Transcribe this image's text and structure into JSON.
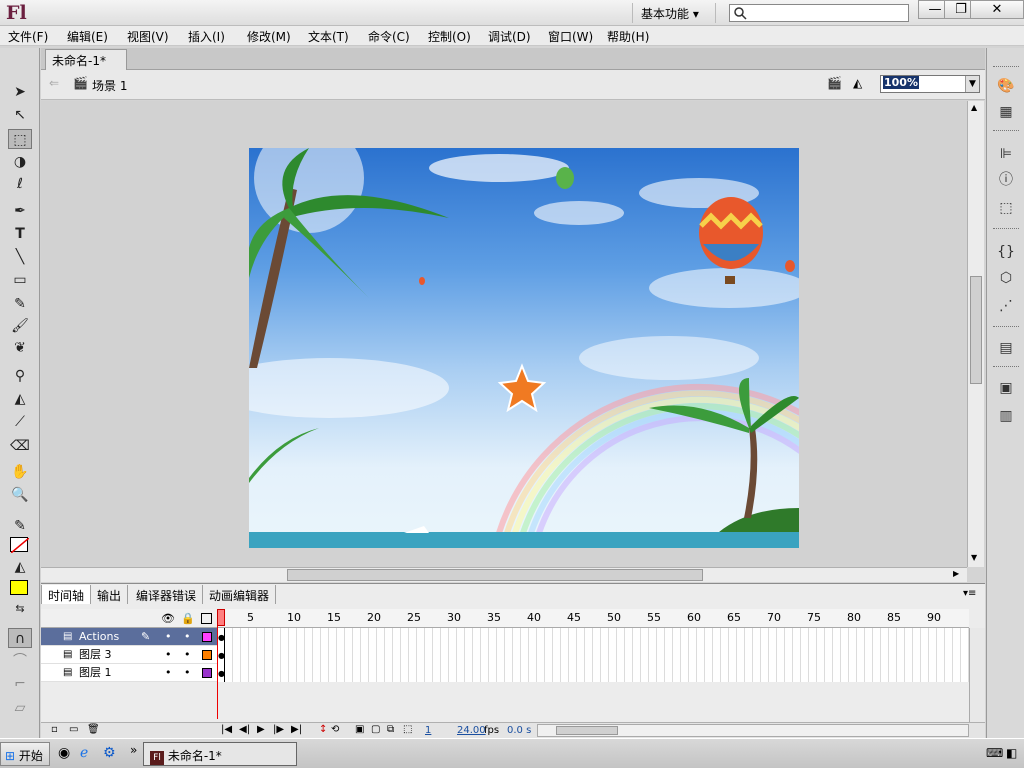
{
  "app": {
    "logo": "Fl",
    "workspace": "基本功能 ▾"
  },
  "window_buttons": {
    "minimize": "—",
    "restore": "❐",
    "close": "✕"
  },
  "menu": [
    "文件(F)",
    "编辑(E)",
    "视图(V)",
    "插入(I)",
    "修改(M)",
    "文本(T)",
    "命令(C)",
    "控制(O)",
    "调试(D)",
    "窗口(W)",
    "帮助(H)"
  ],
  "document": {
    "tab_title": "未命名-1*",
    "tab_close": "×",
    "scene": "场景 1",
    "zoom": "100%"
  },
  "tools": [
    "arrow-icon",
    "subselect-icon",
    "free-transform-icon",
    "3d-rotation-icon",
    "lasso-icon",
    "pen-icon",
    "text-icon",
    "line-icon",
    "rectangle-icon",
    "pencil-icon",
    "brush-icon",
    "deco-icon",
    "bone-icon",
    "paint-bucket-icon",
    "eyedropper-icon",
    "eraser-icon",
    "hand-icon",
    "zoom-icon"
  ],
  "colors": {
    "stroke": "#000000",
    "fill": "#ffff00",
    "actions_layer": "#ff40ff",
    "layer3": "#ff8000",
    "layer1": "#9933cc"
  },
  "timeline": {
    "tabs": [
      "时间轴",
      "输出",
      "编译器错误",
      "动画编辑器"
    ],
    "ruler": [
      "1",
      "5",
      "10",
      "15",
      "20",
      "25",
      "30",
      "35",
      "40",
      "45",
      "50",
      "55",
      "60",
      "65",
      "70",
      "75",
      "80",
      "85",
      "90"
    ],
    "layers": [
      {
        "name": "Actions"
      },
      {
        "name": "图层 3"
      },
      {
        "name": "图层 1"
      }
    ],
    "current_frame": "1",
    "fps": "24.00",
    "fps_unit": "fps",
    "time": "0.0 s"
  },
  "taskbar": {
    "start": "开始",
    "app_label": "未命名-1*",
    "more": "»"
  }
}
